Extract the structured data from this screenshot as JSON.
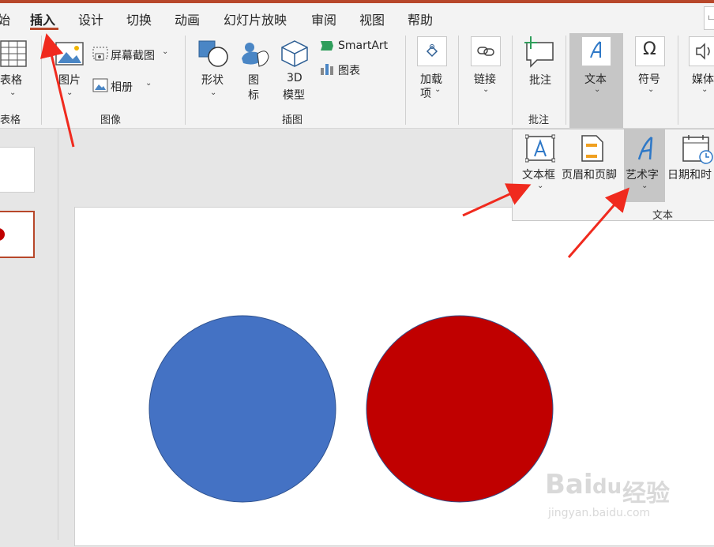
{
  "tabs": [
    {
      "label": "始",
      "active": false
    },
    {
      "label": "插入",
      "active": true
    },
    {
      "label": "设计",
      "active": false
    },
    {
      "label": "切换",
      "active": false
    },
    {
      "label": "动画",
      "active": false
    },
    {
      "label": "幻灯片放映",
      "active": false
    },
    {
      "label": "审阅",
      "active": false
    },
    {
      "label": "视图",
      "active": false
    },
    {
      "label": "帮助",
      "active": false
    }
  ],
  "corner_glyph": "ட",
  "ribbon": {
    "table_group": {
      "button_label": "表格",
      "group_label": "表格"
    },
    "images_group": {
      "picture_label": "图片",
      "screenshot_label": "屏幕截图",
      "album_label": "相册",
      "group_label": "图像"
    },
    "illustrations_group": {
      "shapes_label": "形状",
      "icons_label_1": "图",
      "icons_label_2": "标",
      "model_label_1": "3D",
      "model_label_2": "模型",
      "smartart_label": "SmartArt",
      "chart_label": "图表",
      "group_label": "插图"
    },
    "addins": {
      "label_1": "加载",
      "label_2": "项"
    },
    "links": {
      "label": "链接"
    },
    "comments_group": {
      "button_label": "批注",
      "group_label": "批注"
    },
    "text_btn": {
      "label": "文本"
    },
    "symbols": {
      "label": "符号"
    },
    "media": {
      "label": "媒体"
    }
  },
  "dropdown": {
    "textbox_label": "文本框",
    "header_footer_label": "页眉和页脚",
    "wordart_label": "艺术字",
    "datetime_label": "日期和时",
    "group_label": "文本"
  },
  "colors": {
    "accent": "#b7472a",
    "arrow": "#f02a1e",
    "blue_circle": "#4472c4",
    "red_circle": "#c00000",
    "thumb_shape": "#c00000"
  },
  "watermark": {
    "brand": "Bai",
    "paw": "du",
    "cn": "经验",
    "url": "jingyan.baidu.com"
  }
}
